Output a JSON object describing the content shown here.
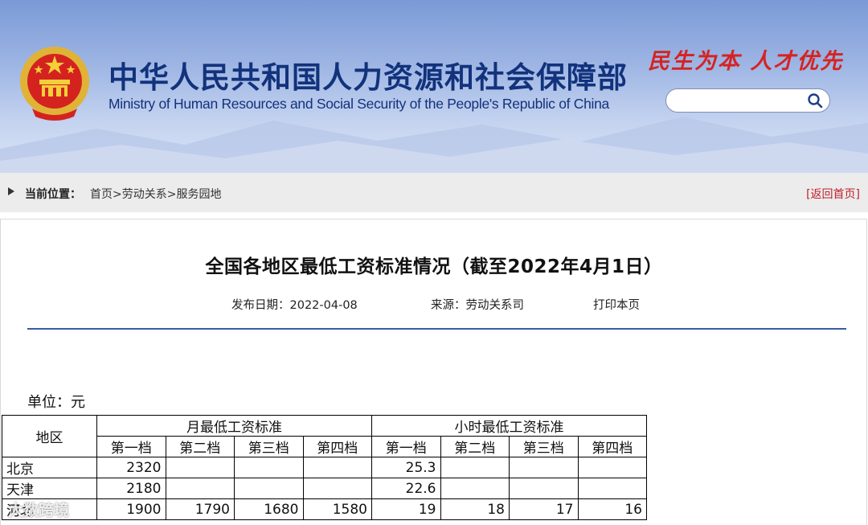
{
  "header": {
    "title_cn": "中华人民共和国人力资源和社会保障部",
    "title_en": "Ministry of Human Resources and Social Security of the People's Republic of China",
    "slogan": "民生为本  人才优先",
    "search_placeholder": ""
  },
  "breadcrumb": {
    "label": "当前位置：",
    "items": [
      "首页",
      "劳动关系",
      "服务园地"
    ],
    "separator": ">",
    "back": "[返回首页]"
  },
  "article": {
    "title": "全国各地区最低工资标准情况（截至2022年4月1日）",
    "date": "发布日期：2022-04-08",
    "source": "来源：劳动关系司",
    "print": "打印本页",
    "unit": "单位：元"
  },
  "table": {
    "region_header": "地区",
    "monthly_header": "月最低工资标准",
    "hourly_header": "小时最低工资标准",
    "tiers": [
      "第一档",
      "第二档",
      "第三档",
      "第四档"
    ],
    "rows": [
      {
        "region": "北京",
        "monthly": [
          "2320",
          "",
          "",
          ""
        ],
        "hourly": [
          "25.3",
          "",
          "",
          ""
        ]
      },
      {
        "region": "天津",
        "monthly": [
          "2180",
          "",
          "",
          ""
        ],
        "hourly": [
          "22.6",
          "",
          "",
          ""
        ]
      },
      {
        "region": "河北",
        "monthly": [
          "1900",
          "1790",
          "1680",
          "1580"
        ],
        "hourly": [
          "19",
          "18",
          "17",
          "16"
        ]
      }
    ]
  },
  "watermark": "大数跨境",
  "colors": {
    "title_blue": "#12327c",
    "slogan_red": "#d52322",
    "rule_blue": "#3b5aa6",
    "back_link_red": "#c0202a"
  }
}
